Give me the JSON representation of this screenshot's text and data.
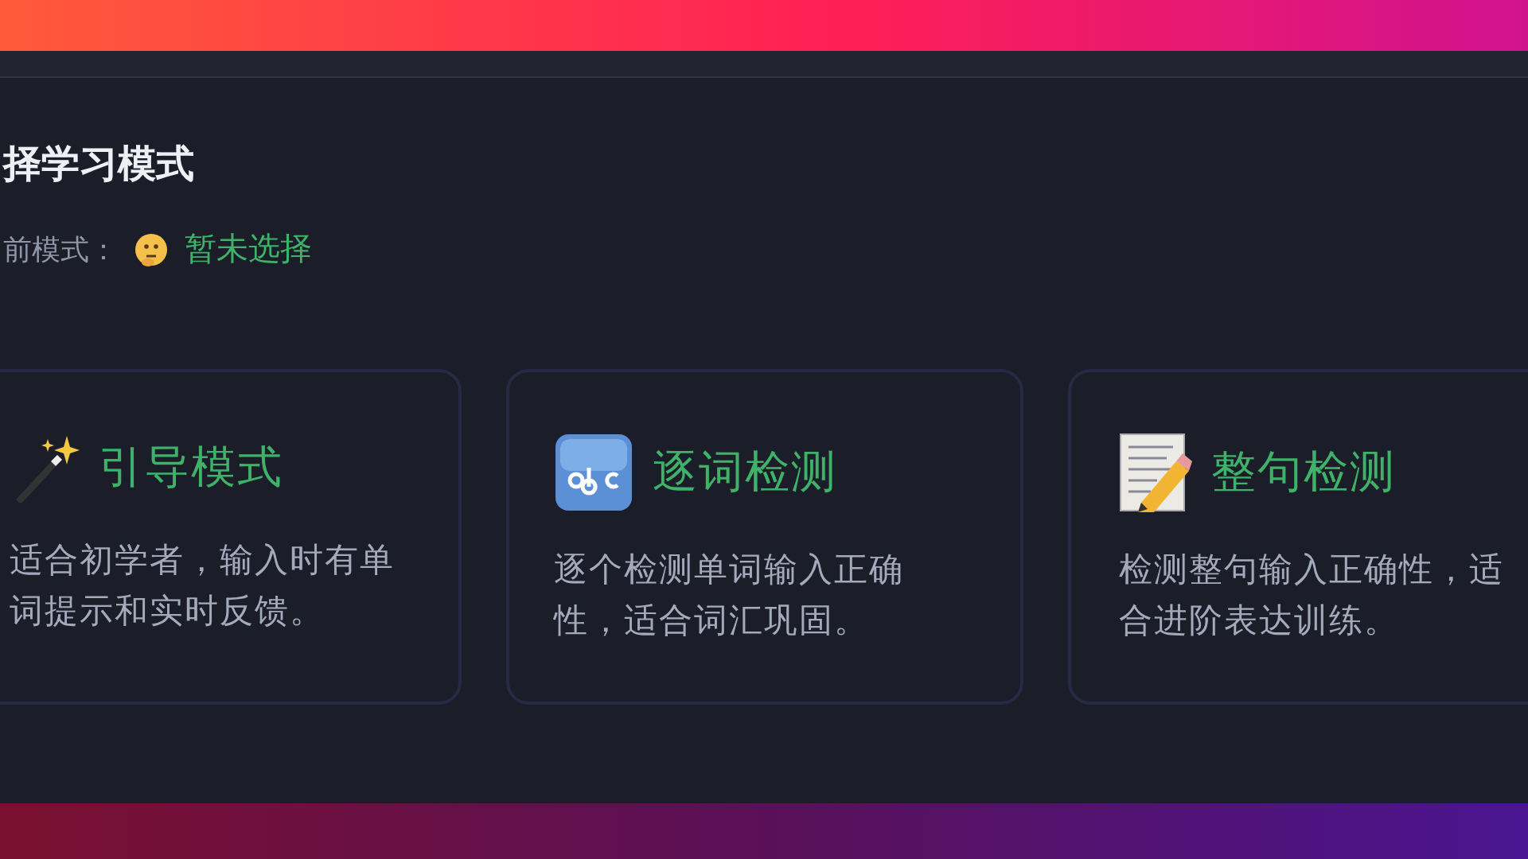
{
  "heading": "择学习模式",
  "current_mode": {
    "label": "前模式：",
    "value": "暂未选择"
  },
  "modes": [
    {
      "kind": "guided",
      "title": "引导模式",
      "description_lines": [
        "适合初学者，输入时有单",
        "词提示和实时反馈。"
      ]
    },
    {
      "kind": "word",
      "title": "逐词检测",
      "description_lines": [
        "逐个检测单词输入正确",
        "性，适合词汇巩固。"
      ]
    },
    {
      "kind": "sentence",
      "title": "整句检测",
      "description_lines": [
        "检测整句输入正确性，适",
        "合进阶表达训练。"
      ]
    }
  ]
}
